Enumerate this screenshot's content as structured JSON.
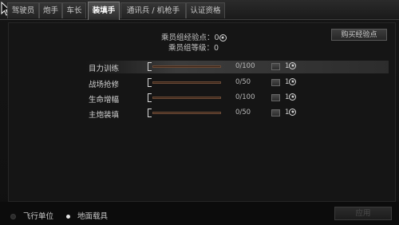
{
  "tabs": [
    {
      "label": "驾驶员",
      "active": false
    },
    {
      "label": "炮手",
      "active": false
    },
    {
      "label": "车长",
      "active": false
    },
    {
      "label": "装填手",
      "active": true
    },
    {
      "label": "通讯兵 / 机枪手",
      "active": false
    },
    {
      "label": "认证资格",
      "active": false
    }
  ],
  "crew_info": {
    "exp_label": "乘员组经验点：",
    "exp_value": "0",
    "level_label": "乘员组等级：",
    "level_value": "0",
    "buy_exp_label": "购买经验点"
  },
  "skills": [
    {
      "name": "目力训练",
      "value": "0/100",
      "progress": 0,
      "cost": "1",
      "icon": "star-icon",
      "highlighted": true
    },
    {
      "name": "战场抢修",
      "value": "0/50",
      "progress": 0,
      "cost": "1",
      "icon": "star-icon",
      "highlighted": false
    },
    {
      "name": "生命增幅",
      "value": "0/100",
      "progress": 0,
      "cost": "1",
      "icon": "star-icon",
      "highlighted": false
    },
    {
      "name": "主炮装填",
      "value": "0/50",
      "progress": 0,
      "cost": "1",
      "icon": "star-icon",
      "highlighted": false
    }
  ],
  "footer": {
    "unit_options": [
      {
        "label": "飞行单位",
        "selected": false
      },
      {
        "label": "地面载具",
        "selected": true
      }
    ],
    "apply_label": "应用"
  },
  "colors": {
    "slider_track": "#3a2418",
    "slider_border": "#6a4a36",
    "slider_fill": "#c28a5a"
  }
}
